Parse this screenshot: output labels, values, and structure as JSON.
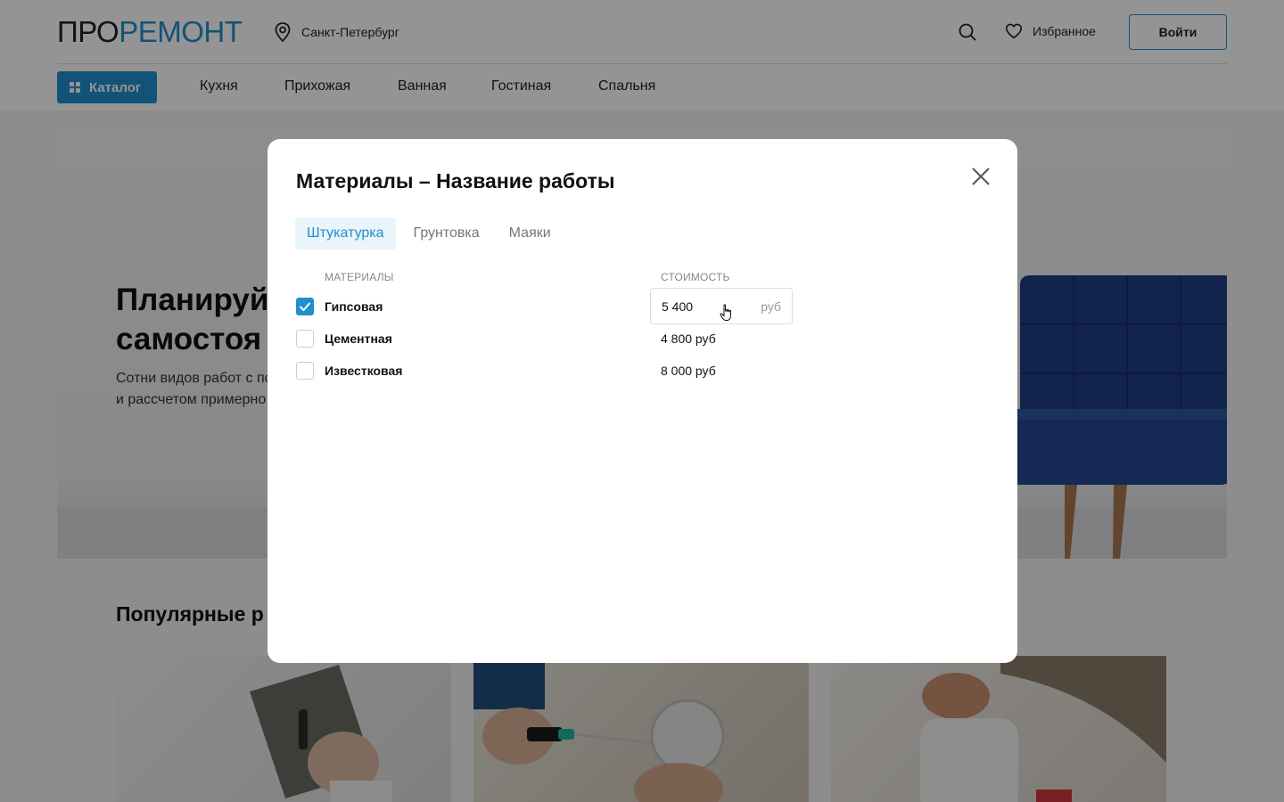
{
  "header": {
    "logo_pro": "ПРО",
    "logo_remont": "РЕМОНТ",
    "city": "Санкт-Петербург",
    "favorites": "Избранное",
    "login": "Войти",
    "catalog": "Каталог",
    "nav": [
      "Кухня",
      "Прихожая",
      "Ванная",
      "Гостиная",
      "Спальня"
    ]
  },
  "hero": {
    "title_line1": "Планируй",
    "title_line2": "самостоя",
    "subtitle_line1": "Сотни видов работ с по",
    "subtitle_line2": "и рассчетом примерно"
  },
  "popular": {
    "title": "Популярные р"
  },
  "modal": {
    "title": "Материалы – Название работы",
    "tabs": [
      "Штукатурка",
      "Грунтовка",
      "Маяки"
    ],
    "active_tab": "Штукатурка",
    "col_materials": "МАТЕРИАЛЫ",
    "col_cost": "СТОИМОСТЬ",
    "rows": [
      {
        "name": "Гипсовая",
        "checked": true,
        "cost_value": "5 400",
        "cost_unit": "руб"
      },
      {
        "name": "Цементная",
        "checked": false,
        "cost": "4 800 руб"
      },
      {
        "name": "Известковая",
        "checked": false,
        "cost": "8 000 руб"
      }
    ]
  },
  "colors": {
    "accent": "#1f8fce",
    "overlay": "rgba(0,0,0,0.42)",
    "sofa": "#1f3f86"
  },
  "icons": [
    "location-pin-icon",
    "search-icon",
    "heart-icon",
    "grid-icon",
    "close-icon",
    "check-icon",
    "hand-cursor-icon"
  ]
}
